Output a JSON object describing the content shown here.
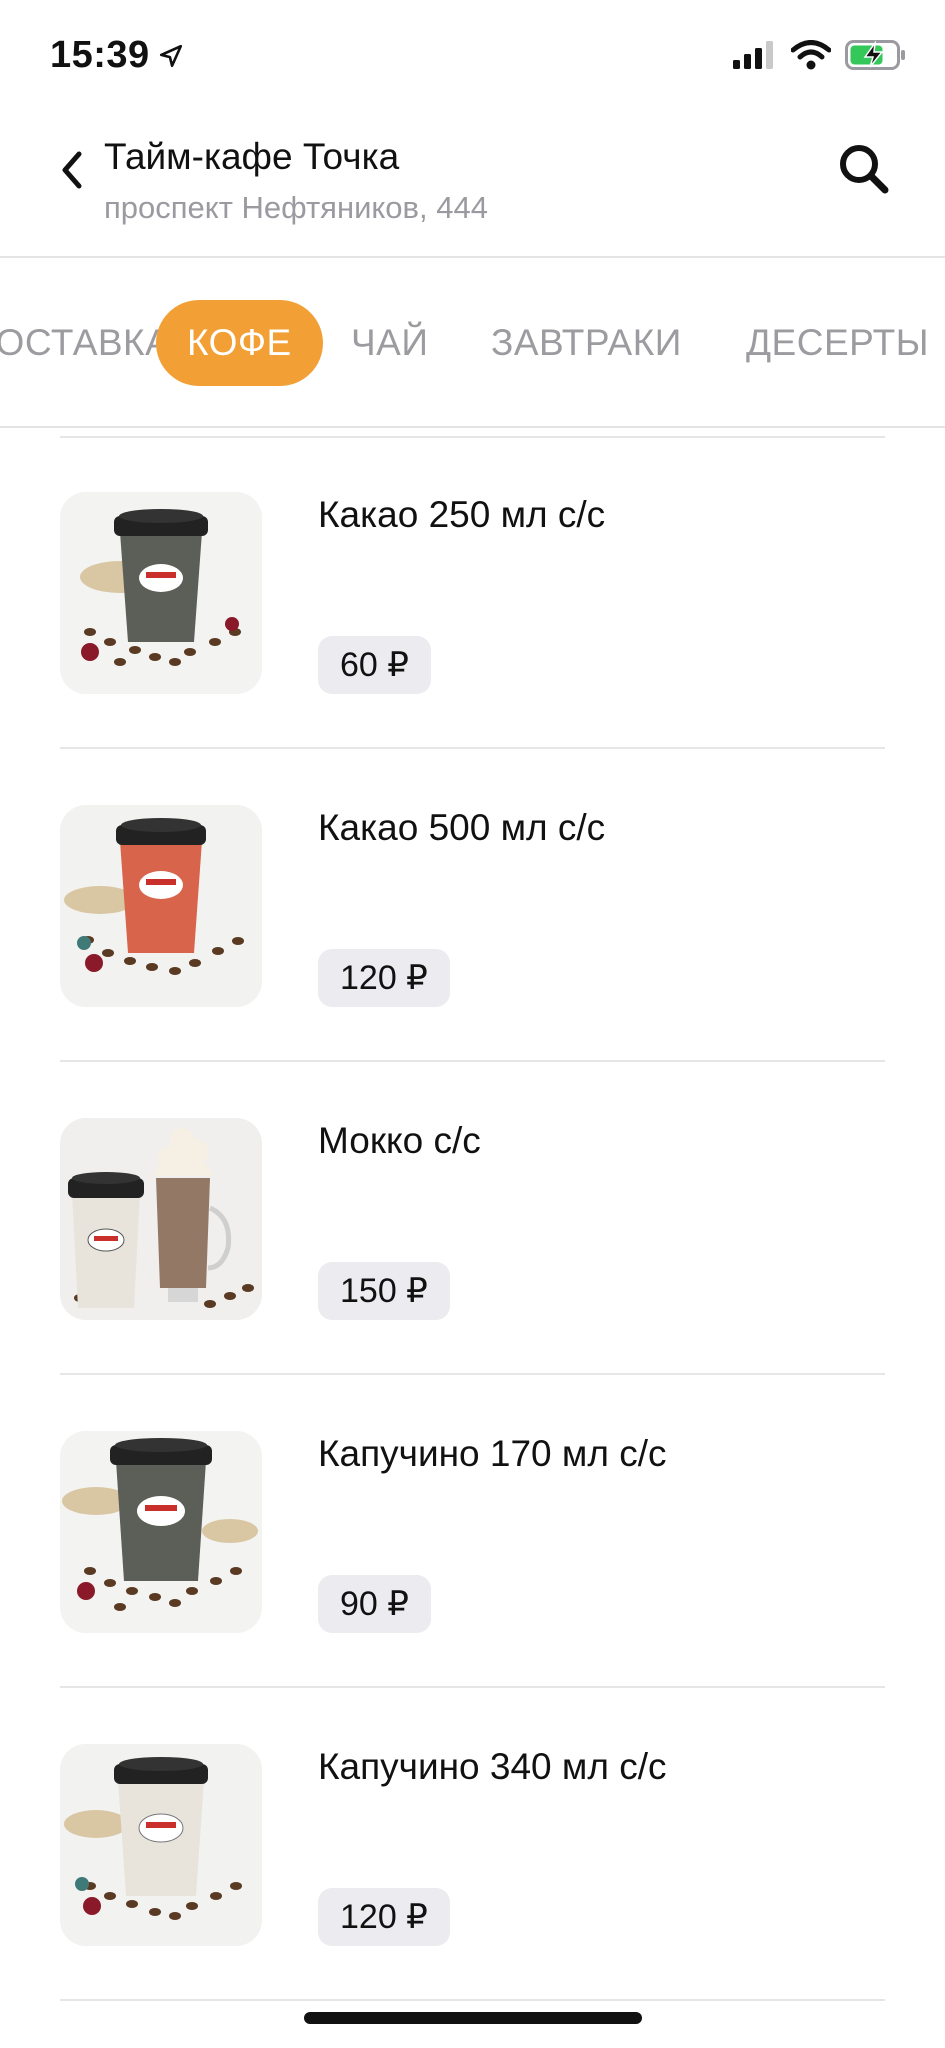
{
  "status_bar": {
    "time": "15:39",
    "location_icon": "location-arrow-icon",
    "signal_icon": "cellular-signal-icon",
    "wifi_icon": "wifi-icon",
    "battery_icon": "battery-charging-icon",
    "battery_color": "#34c759"
  },
  "header": {
    "title": "Тайм-кафе Точка",
    "subtitle": "проспект Нефтяников, 444",
    "back_icon": "chevron-left-icon",
    "search_icon": "search-icon"
  },
  "tabs": [
    {
      "label": "ДОСТАВКА",
      "active": false
    },
    {
      "label": "КОФЕ",
      "active": true
    },
    {
      "label": "ЧАЙ",
      "active": false
    },
    {
      "label": "ЗАВТРАКИ",
      "active": false
    },
    {
      "label": "ДЕСЕРТЫ",
      "active": false
    }
  ],
  "accent_color": "#f2a035",
  "menu_items": [
    {
      "name": "Какао 250 мл с/с",
      "price": "60 ₽",
      "cup_color": "#5c5f58"
    },
    {
      "name": "Какао 500 мл с/с",
      "price": "120 ₽",
      "cup_color": "#d9644c"
    },
    {
      "name": "Мокко с/с",
      "price": "150 ₽",
      "cup_color": "#e8e4dc"
    },
    {
      "name": "Капучино 170 мл с/с",
      "price": "90 ₽",
      "cup_color": "#5c5f58"
    },
    {
      "name": "Капучино 340 мл с/с",
      "price": "120 ₽",
      "cup_color": "#e8e4dc"
    }
  ]
}
